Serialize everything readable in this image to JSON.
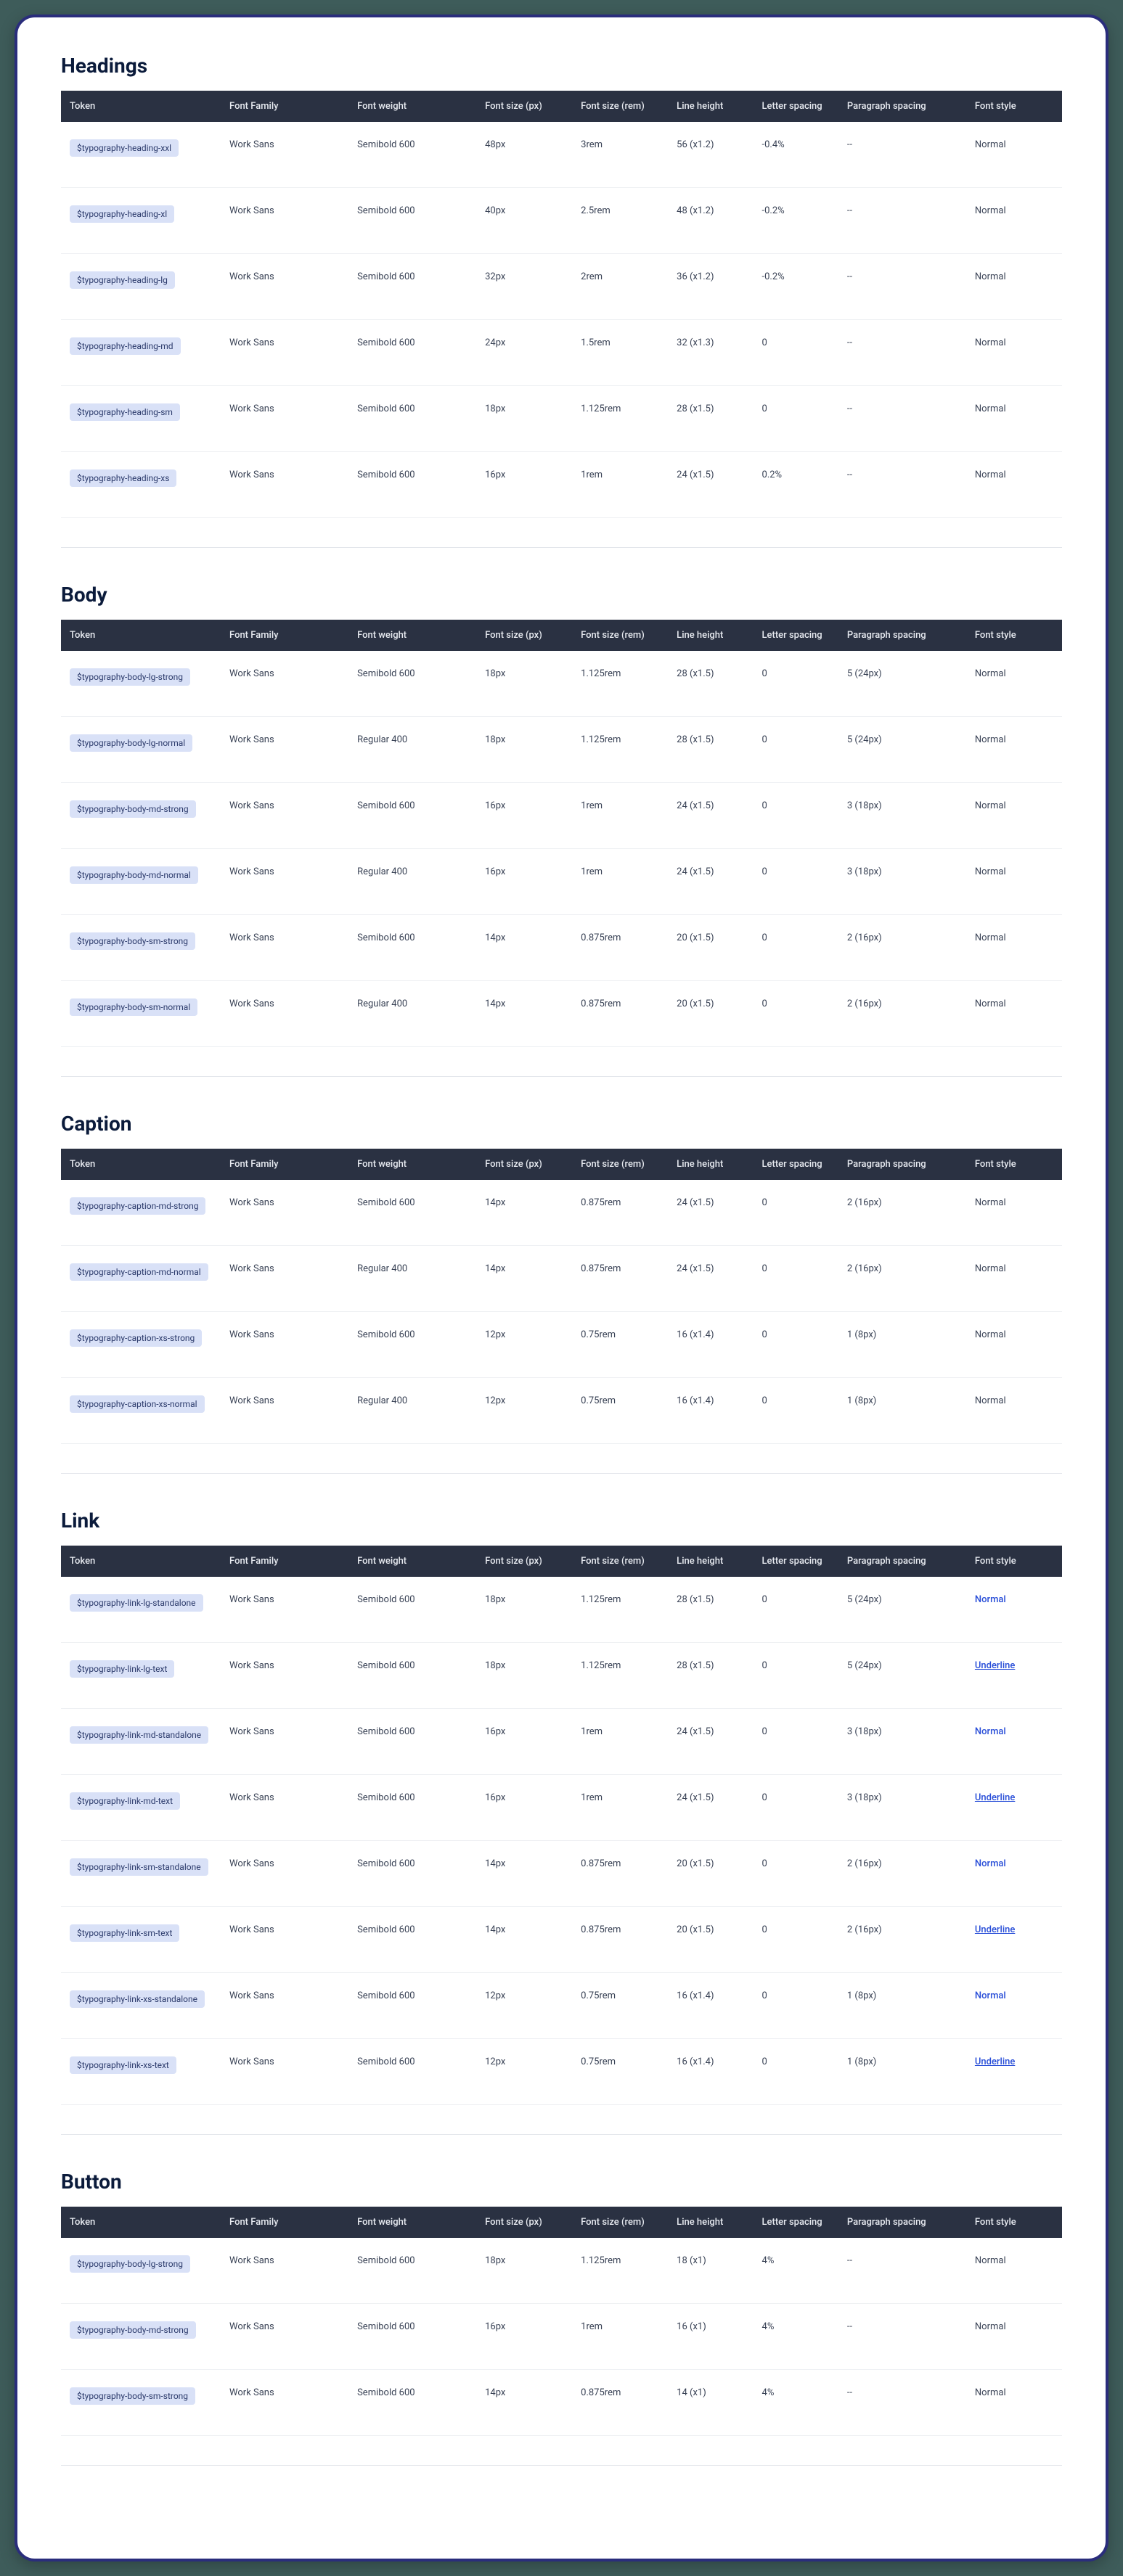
{
  "columns": {
    "token": "Token",
    "family": "Font Family",
    "weight": "Font weight",
    "sizePx": "Font size (px)",
    "sizeRem": "Font size (rem)",
    "lineHeight": "Line height",
    "letterSpacing": "Letter spacing",
    "paraSpacing": "Paragraph spacing",
    "fontStyle": "Font style"
  },
  "sections": [
    {
      "title": "Headings",
      "rows": [
        {
          "token": "$typography-heading-xxl",
          "family": "Work Sans",
          "weight": "Semibold 600",
          "sizePx": "48px",
          "sizeRem": "3rem",
          "lineHeight": "56 (x1.2)",
          "letterSpacing": "-0.4%",
          "paraSpacing": "--",
          "fontStyle": "Normal",
          "linkStyle": ""
        },
        {
          "token": "$typography-heading-xl",
          "family": "Work Sans",
          "weight": "Semibold 600",
          "sizePx": "40px",
          "sizeRem": "2.5rem",
          "lineHeight": "48 (x1.2)",
          "letterSpacing": "-0.2%",
          "paraSpacing": "--",
          "fontStyle": "Normal",
          "linkStyle": ""
        },
        {
          "token": "$typography-heading-lg",
          "family": "Work Sans",
          "weight": "Semibold 600",
          "sizePx": "32px",
          "sizeRem": "2rem",
          "lineHeight": "36 (x1.2)",
          "letterSpacing": "-0.2%",
          "paraSpacing": "--",
          "fontStyle": "Normal",
          "linkStyle": ""
        },
        {
          "token": "$typography-heading-md",
          "family": "Work Sans",
          "weight": "Semibold 600",
          "sizePx": "24px",
          "sizeRem": "1.5rem",
          "lineHeight": "32 (x1.3)",
          "letterSpacing": "0",
          "paraSpacing": "--",
          "fontStyle": "Normal",
          "linkStyle": ""
        },
        {
          "token": "$typography-heading-sm",
          "family": "Work Sans",
          "weight": "Semibold 600",
          "sizePx": "18px",
          "sizeRem": "1.125rem",
          "lineHeight": "28 (x1.5)",
          "letterSpacing": "0",
          "paraSpacing": "--",
          "fontStyle": "Normal",
          "linkStyle": ""
        },
        {
          "token": "$typography-heading-xs",
          "family": "Work Sans",
          "weight": "Semibold 600",
          "sizePx": "16px",
          "sizeRem": "1rem",
          "lineHeight": "24 (x1.5)",
          "letterSpacing": "0.2%",
          "paraSpacing": "--",
          "fontStyle": "Normal",
          "linkStyle": ""
        }
      ]
    },
    {
      "title": "Body",
      "rows": [
        {
          "token": "$typography-body-lg-strong",
          "family": "Work Sans",
          "weight": "Semibold 600",
          "sizePx": "18px",
          "sizeRem": "1.125rem",
          "lineHeight": "28 (x1.5)",
          "letterSpacing": "0",
          "paraSpacing": "5 (24px)",
          "fontStyle": "Normal",
          "linkStyle": ""
        },
        {
          "token": "$typography-body-lg-normal",
          "family": "Work Sans",
          "weight": "Regular 400",
          "sizePx": "18px",
          "sizeRem": "1.125rem",
          "lineHeight": "28 (x1.5)",
          "letterSpacing": "0",
          "paraSpacing": "5 (24px)",
          "fontStyle": "Normal",
          "linkStyle": ""
        },
        {
          "token": "$typography-body-md-strong",
          "family": "Work Sans",
          "weight": "Semibold 600",
          "sizePx": "16px",
          "sizeRem": "1rem",
          "lineHeight": "24 (x1.5)",
          "letterSpacing": "0",
          "paraSpacing": "3 (18px)",
          "fontStyle": "Normal",
          "linkStyle": ""
        },
        {
          "token": "$typography-body-md-normal",
          "family": "Work Sans",
          "weight": "Regular 400",
          "sizePx": "16px",
          "sizeRem": "1rem",
          "lineHeight": "24 (x1.5)",
          "letterSpacing": "0",
          "paraSpacing": "3 (18px)",
          "fontStyle": "Normal",
          "linkStyle": ""
        },
        {
          "token": "$typography-body-sm-strong",
          "family": "Work Sans",
          "weight": "Semibold 600",
          "sizePx": "14px",
          "sizeRem": "0.875rem",
          "lineHeight": "20 (x1.5)",
          "letterSpacing": "0",
          "paraSpacing": "2 (16px)",
          "fontStyle": "Normal",
          "linkStyle": ""
        },
        {
          "token": "$typography-body-sm-normal",
          "family": "Work Sans",
          "weight": "Regular 400",
          "sizePx": "14px",
          "sizeRem": "0.875rem",
          "lineHeight": "20 (x1.5)",
          "letterSpacing": "0",
          "paraSpacing": "2 (16px)",
          "fontStyle": "Normal",
          "linkStyle": ""
        }
      ]
    },
    {
      "title": "Caption",
      "rows": [
        {
          "token": "$typography-caption-md-strong",
          "family": "Work Sans",
          "weight": "Semibold 600",
          "sizePx": "14px",
          "sizeRem": "0.875rem",
          "lineHeight": "24 (x1.5)",
          "letterSpacing": "0",
          "paraSpacing": "2 (16px)",
          "fontStyle": "Normal",
          "linkStyle": ""
        },
        {
          "token": "$typography-caption-md-normal",
          "family": "Work Sans",
          "weight": "Regular 400",
          "sizePx": "14px",
          "sizeRem": "0.875rem",
          "lineHeight": "24 (x1.5)",
          "letterSpacing": "0",
          "paraSpacing": "2 (16px)",
          "fontStyle": "Normal",
          "linkStyle": ""
        },
        {
          "token": "$typography-caption-xs-strong",
          "family": "Work Sans",
          "weight": "Semibold 600",
          "sizePx": "12px",
          "sizeRem": "0.75rem",
          "lineHeight": "16 (x1.4)",
          "letterSpacing": "0",
          "paraSpacing": "1 (8px)",
          "fontStyle": "Normal",
          "linkStyle": ""
        },
        {
          "token": "$typography-caption-xs-normal",
          "family": "Work Sans",
          "weight": "Regular 400",
          "sizePx": "12px",
          "sizeRem": "0.75rem",
          "lineHeight": "16 (x1.4)",
          "letterSpacing": "0",
          "paraSpacing": "1 (8px)",
          "fontStyle": "Normal",
          "linkStyle": ""
        }
      ]
    },
    {
      "title": "Link",
      "rows": [
        {
          "token": "$typography-link-lg-standalone",
          "family": "Work Sans",
          "weight": "Semibold 600",
          "sizePx": "18px",
          "sizeRem": "1.125rem",
          "lineHeight": "28 (x1.5)",
          "letterSpacing": "0",
          "paraSpacing": "5 (24px)",
          "fontStyle": "Normal",
          "linkStyle": "blue"
        },
        {
          "token": "$typography-link-lg-text",
          "family": "Work Sans",
          "weight": "Semibold 600",
          "sizePx": "18px",
          "sizeRem": "1.125rem",
          "lineHeight": "28 (x1.5)",
          "letterSpacing": "0",
          "paraSpacing": "5 (24px)",
          "fontStyle": "Underline",
          "linkStyle": "underline"
        },
        {
          "token": "$typography-link-md-standalone",
          "family": "Work Sans",
          "weight": "Semibold 600",
          "sizePx": "16px",
          "sizeRem": "1rem",
          "lineHeight": "24 (x1.5)",
          "letterSpacing": "0",
          "paraSpacing": "3 (18px)",
          "fontStyle": "Normal",
          "linkStyle": "blue"
        },
        {
          "token": "$typography-link-md-text",
          "family": "Work Sans",
          "weight": "Semibold 600",
          "sizePx": "16px",
          "sizeRem": "1rem",
          "lineHeight": "24 (x1.5)",
          "letterSpacing": "0",
          "paraSpacing": "3 (18px)",
          "fontStyle": "Underline",
          "linkStyle": "underline"
        },
        {
          "token": "$typography-link-sm-standalone",
          "family": "Work Sans",
          "weight": "Semibold 600",
          "sizePx": "14px",
          "sizeRem": "0.875rem",
          "lineHeight": "20 (x1.5)",
          "letterSpacing": "0",
          "paraSpacing": "2 (16px)",
          "fontStyle": "Normal",
          "linkStyle": "blue"
        },
        {
          "token": "$typography-link-sm-text",
          "family": "Work Sans",
          "weight": "Semibold 600",
          "sizePx": "14px",
          "sizeRem": "0.875rem",
          "lineHeight": "20 (x1.5)",
          "letterSpacing": "0",
          "paraSpacing": "2 (16px)",
          "fontStyle": "Underline",
          "linkStyle": "underline"
        },
        {
          "token": "$typography-link-xs-standalone",
          "family": "Work Sans",
          "weight": "Semibold 600",
          "sizePx": "12px",
          "sizeRem": "0.75rem",
          "lineHeight": "16 (x1.4)",
          "letterSpacing": "0",
          "paraSpacing": "1 (8px)",
          "fontStyle": "Normal",
          "linkStyle": "blue"
        },
        {
          "token": "$typography-link-xs-text",
          "family": "Work Sans",
          "weight": "Semibold 600",
          "sizePx": "12px",
          "sizeRem": "0.75rem",
          "lineHeight": "16 (x1.4)",
          "letterSpacing": "0",
          "paraSpacing": "1 (8px)",
          "fontStyle": "Underline",
          "linkStyle": "underline"
        }
      ]
    },
    {
      "title": "Button",
      "rows": [
        {
          "token": "$typography-body-lg-strong",
          "family": "Work Sans",
          "weight": "Semibold 600",
          "sizePx": "18px",
          "sizeRem": "1.125rem",
          "lineHeight": "18 (x1)",
          "letterSpacing": "4%",
          "paraSpacing": "--",
          "fontStyle": "Normal",
          "linkStyle": ""
        },
        {
          "token": "$typography-body-md-strong",
          "family": "Work Sans",
          "weight": "Semibold 600",
          "sizePx": "16px",
          "sizeRem": "1rem",
          "lineHeight": "16 (x1)",
          "letterSpacing": "4%",
          "paraSpacing": "--",
          "fontStyle": "Normal",
          "linkStyle": ""
        },
        {
          "token": "$typography-body-sm-strong",
          "family": "Work Sans",
          "weight": "Semibold 600",
          "sizePx": "14px",
          "sizeRem": "0.875rem",
          "lineHeight": "14 (x1)",
          "letterSpacing": "4%",
          "paraSpacing": "--",
          "fontStyle": "Normal",
          "linkStyle": ""
        }
      ]
    }
  ]
}
